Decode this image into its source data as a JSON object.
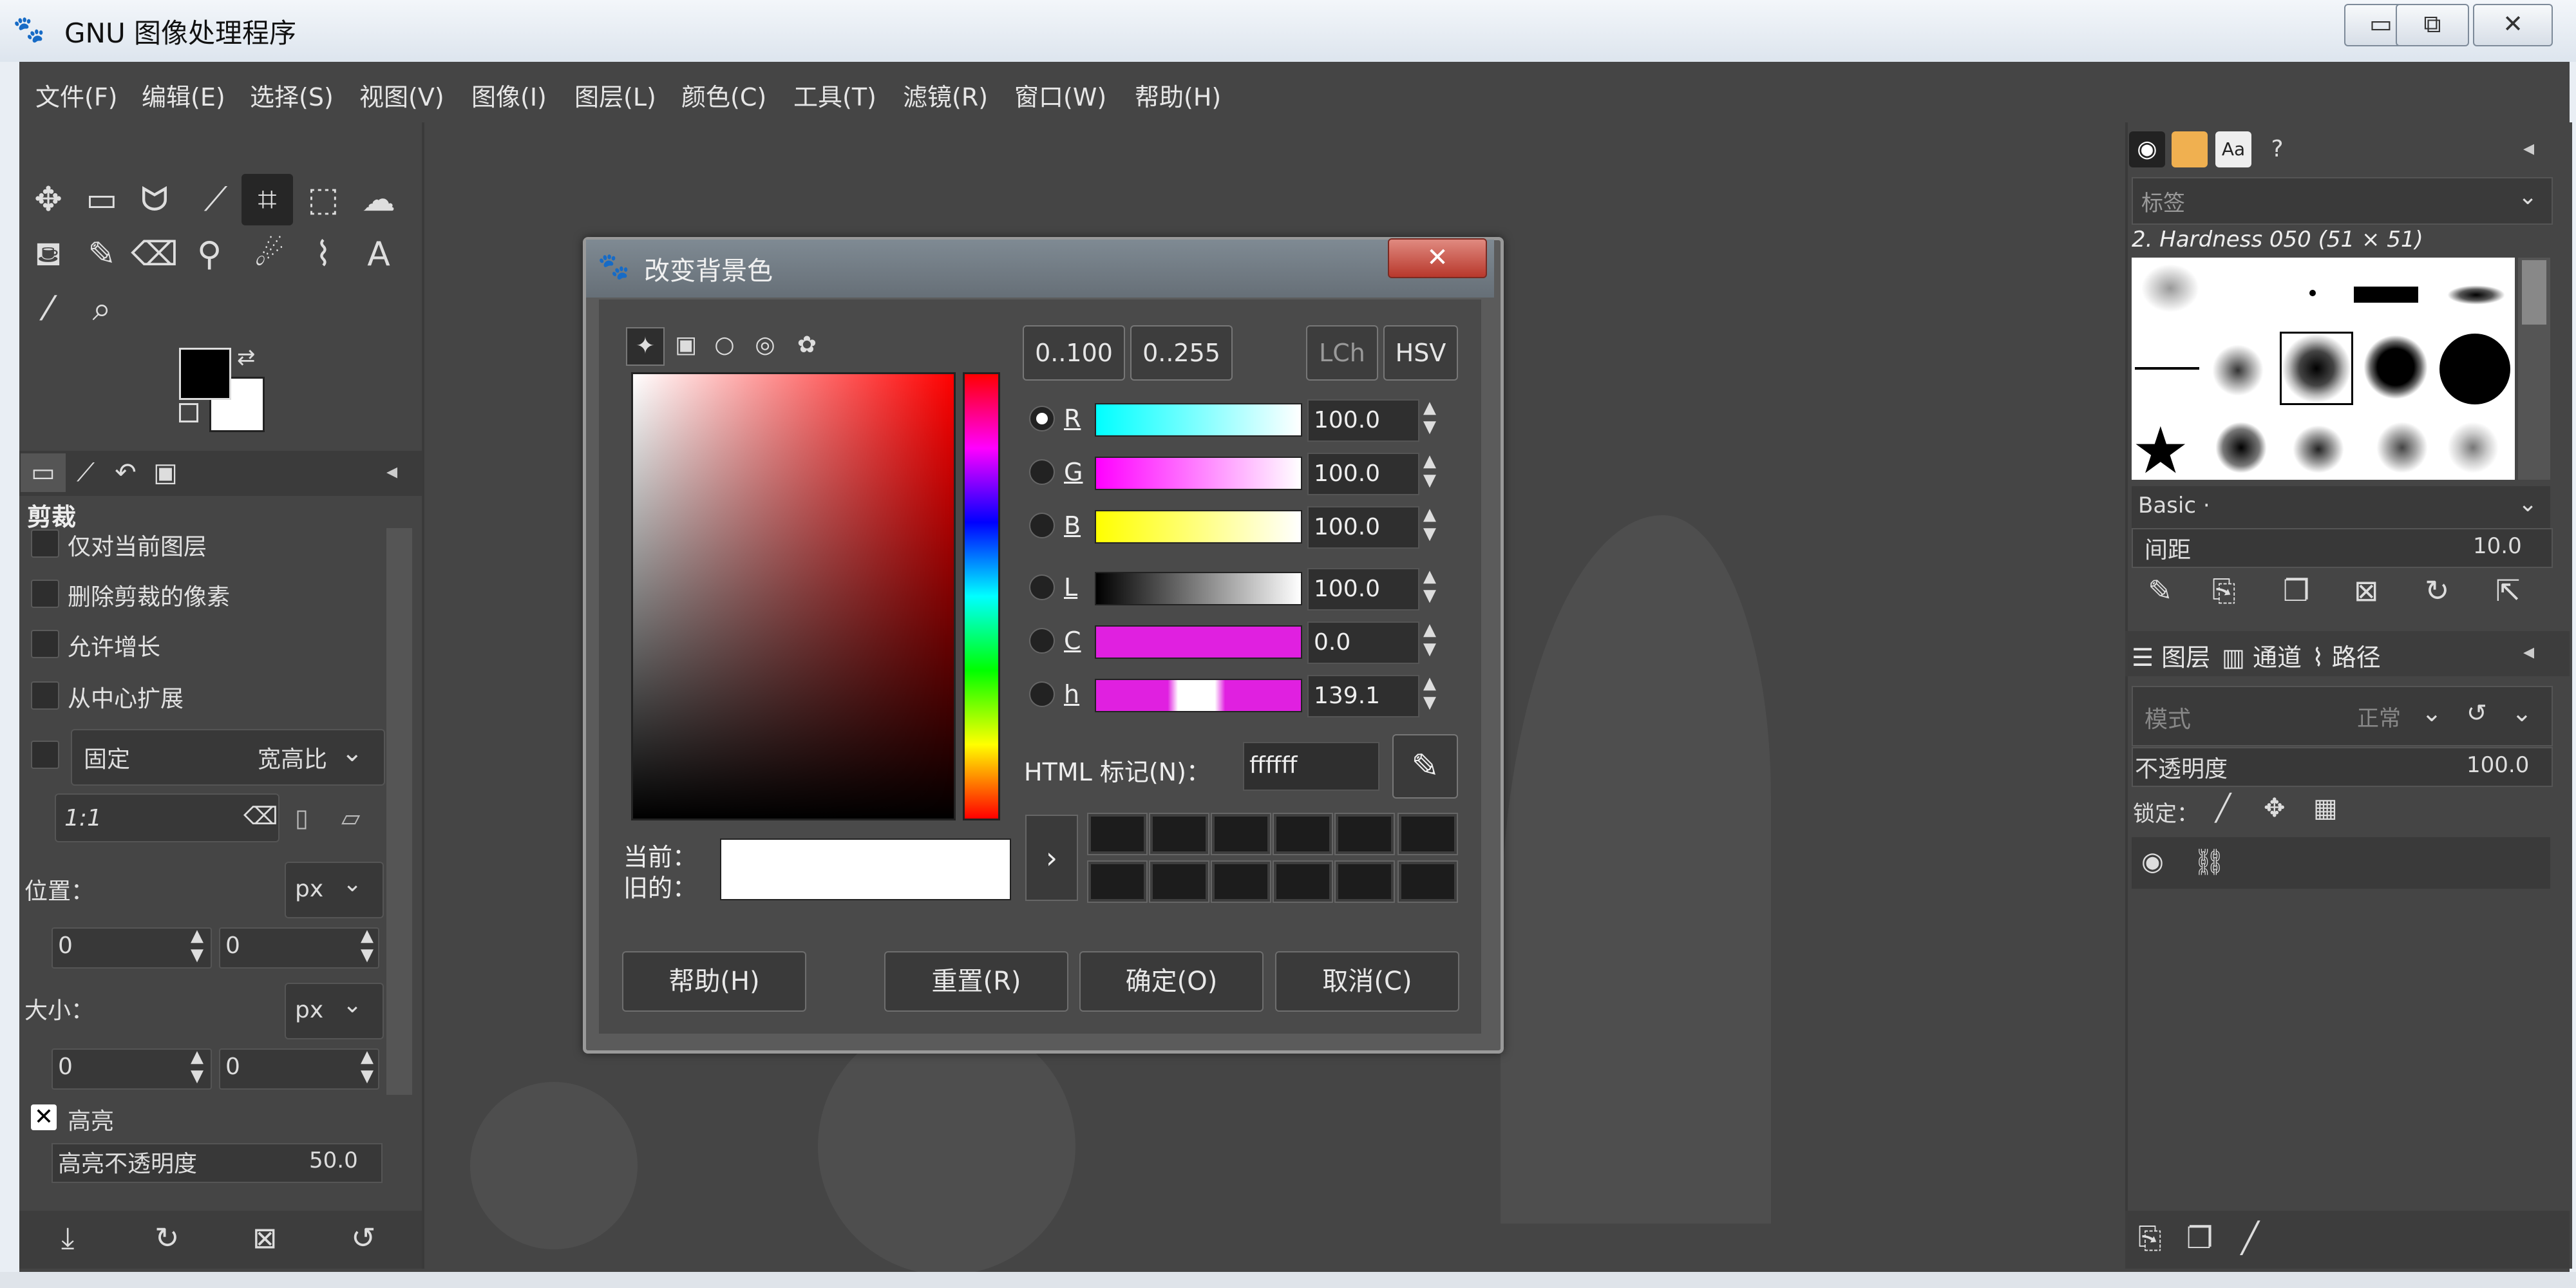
{
  "window": {
    "title": "GNU 图像处理程序",
    "minimize": "▭",
    "maximize": "⧉",
    "close": "✕"
  },
  "menubar": [
    "文件(F)",
    "编辑(E)",
    "选择(S)",
    "视图(V)",
    "图像(I)",
    "图层(L)",
    "颜色(C)",
    "工具(T)",
    "滤镜(R)",
    "窗口(W)",
    "帮助(H)"
  ],
  "toolbox": {
    "tools": [
      "move-tool",
      "rect-select-tool",
      "lasso-tool",
      "fuzzy-select-tool",
      "crop-tool",
      "unified-transform-tool",
      "warp-tool",
      "bucket-fill-tool",
      "paintbrush-tool",
      "eraser-tool",
      "clone-tool",
      "smudge-tool",
      "paths-tool",
      "text-tool",
      "color-picker-tool",
      "zoom-tool"
    ],
    "fg_color": "#000000",
    "bg_color": "#ffffff"
  },
  "tool_options": {
    "title": "剪裁",
    "checkboxes": [
      "仅对当前图层",
      "删除剪裁的像素",
      "允许增长",
      "从中心扩展"
    ],
    "fixed_label": "固定",
    "fixed_value": "宽高比",
    "ratio": "1:1",
    "position_label": "位置：",
    "position_unit": "px",
    "position_x": "0",
    "position_y": "0",
    "size_label": "大小：",
    "size_unit": "px",
    "size_w": "0",
    "size_h": "0",
    "highlight_label": "高亮",
    "highlight_opacity_label": "高亮不透明度",
    "highlight_opacity_value": "50.0"
  },
  "dialog": {
    "title": "改变背景色",
    "close": "✕",
    "range_buttons": [
      "0..100",
      "0..255"
    ],
    "mode_buttons": [
      "LCh",
      "HSV"
    ],
    "channels": [
      {
        "label": "R",
        "value": "100.0",
        "selected": true
      },
      {
        "label": "G",
        "value": "100.0",
        "selected": false
      },
      {
        "label": "B",
        "value": "100.0",
        "selected": false
      },
      {
        "label": "L",
        "value": "100.0",
        "selected": false
      },
      {
        "label": "C",
        "value": "0.0",
        "selected": false
      },
      {
        "label": "h",
        "value": "139.1",
        "selected": false
      }
    ],
    "html_label": "HTML 标记(N)：",
    "html_value": "ffffff",
    "current_label": "当前：",
    "old_label": "旧的：",
    "add_history": "›",
    "buttons": {
      "help": "帮助(H)",
      "reset": "重置(R)",
      "ok": "确定(O)",
      "cancel": "取消(C)"
    }
  },
  "brushes": {
    "filter_placeholder": "标签",
    "current": "2. Hardness 050 (51 × 51)",
    "preset": "Basic ·",
    "spacing_label": "间距",
    "spacing_value": "10.0"
  },
  "layers": {
    "tabs": [
      "图层",
      "通道",
      "路径"
    ],
    "mode": "模式",
    "mode_value": "正常",
    "opacity_label": "不透明度",
    "opacity_value": "100.0",
    "lock_label": "锁定："
  }
}
